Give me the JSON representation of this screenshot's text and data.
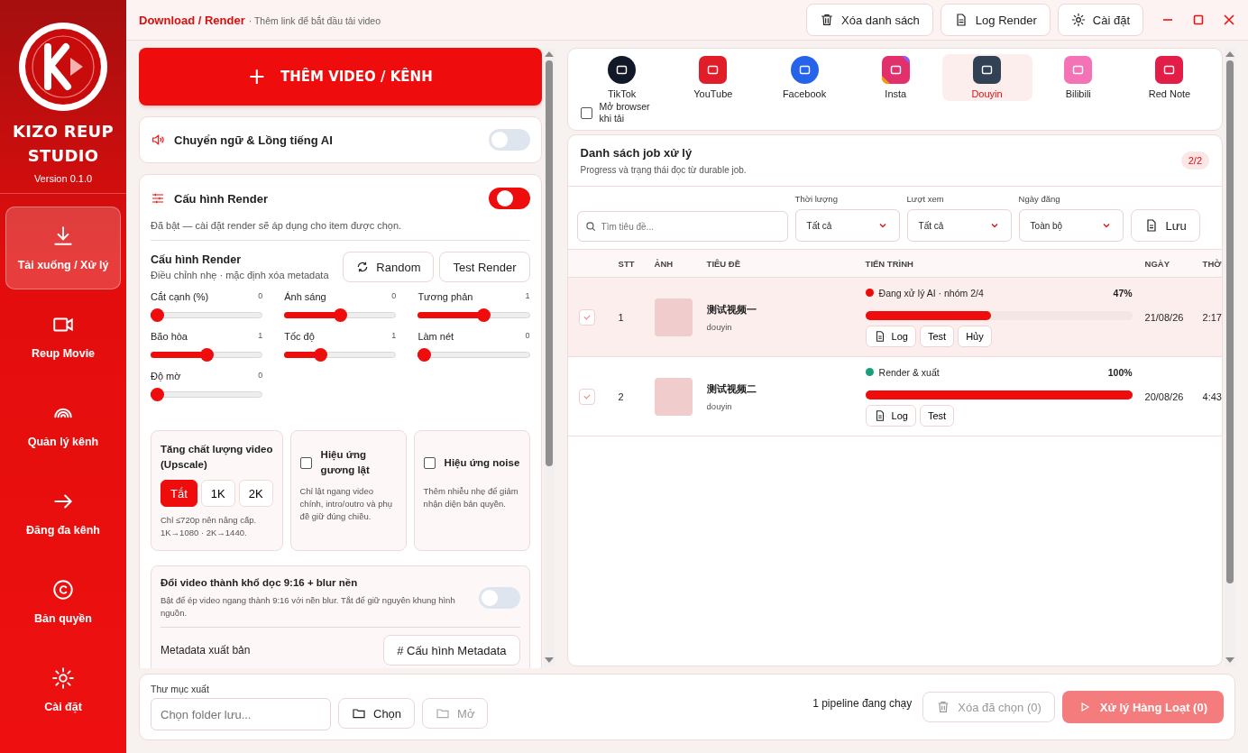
{
  "app": {
    "name_line1": "KIZO REUP",
    "name_line2": "STUDIO",
    "version": "Version 0.1.0"
  },
  "nav": [
    {
      "label": "Tải xuống / Xử lý",
      "kind": "download",
      "selected": true
    },
    {
      "label": "Reup Movie",
      "kind": "video",
      "selected": false
    },
    {
      "label": "Quản lý kênh",
      "kind": "signal",
      "selected": false
    },
    {
      "label": "Đăng đa kênh",
      "kind": "arrow",
      "selected": false
    },
    {
      "label": "Bản quyền",
      "kind": "copyright",
      "selected": false
    },
    {
      "label": "Cài đặt",
      "kind": "gear",
      "selected": false
    }
  ],
  "header": {
    "title": "Download / Render",
    "subtitle": "· Thêm link để bắt đầu tải video",
    "buttons": [
      {
        "label": "Xóa danh sách",
        "kind": "trash"
      },
      {
        "label": "Log Render",
        "kind": "doc"
      },
      {
        "label": "Cài đặt",
        "kind": "gear"
      }
    ]
  },
  "add_button": {
    "icon": "+",
    "label": "THÊM VIDEO / KÊNH"
  },
  "ai_card": {
    "title": "Chuyển ngữ & Lồng tiếng AI",
    "on": false
  },
  "render_card": {
    "title": "Cấu hình Render",
    "on": true,
    "note": "Đã bật — cài đặt render sẽ áp dụng cho item được chọn.",
    "section_title": "Cấu hình Render",
    "section_sub": "Điều chỉnh nhẹ · mặc định xóa metadata",
    "random": "Random",
    "test": "Test Render",
    "sliders": [
      {
        "label": "Cắt cạnh (%)",
        "reading": "0",
        "level": 0
      },
      {
        "label": "Ánh sáng",
        "reading": "0",
        "level": 0.5
      },
      {
        "label": "Tương phản",
        "reading": "1",
        "level": 0.6
      },
      {
        "label": "Bão hòa",
        "reading": "1",
        "level": 0.5
      },
      {
        "label": "Tốc độ",
        "reading": "1",
        "level": 0.3
      },
      {
        "label": "Làm nét",
        "reading": "0",
        "level": 0
      },
      {
        "label": "Độ mờ",
        "reading": "0",
        "level": 0
      }
    ],
    "upscale": {
      "title": "Tăng chất lượng video (Upscale)",
      "options": [
        {
          "label": "Tắt",
          "selected": true
        },
        {
          "label": "1K",
          "selected": false
        },
        {
          "label": "2K",
          "selected": false
        }
      ],
      "note": "Chỉ ≤720p nên nâng cấp. 1K→1080 · 2K→1440."
    },
    "mirror": {
      "title": "Hiệu ứng gương lật",
      "checked": false,
      "note": "Chỉ lật ngang video chính, intro/outro và phụ đề giữ đúng chiều."
    },
    "noise": {
      "title": "Hiệu ứng noise",
      "checked": false,
      "note": "Thêm nhiễu nhẹ để giảm nhận diện bản quyền."
    },
    "vertical": {
      "title": "Đổi video thành khổ dọc 9:16 + blur nền",
      "note": "Bật để ép video ngang thành 9:16 với nền blur. Tắt để giữ nguyên khung hình nguồn.",
      "on": false
    },
    "metadata_label": "Metadata xuất bản",
    "metadata_button": "# Cấu hình Metadata"
  },
  "platforms": [
    {
      "label": "TikTok",
      "kind": "circle",
      "color": "#111827",
      "selected": false
    },
    {
      "label": "YouTube",
      "kind": "square",
      "color": "#e11d2a",
      "selected": false
    },
    {
      "label": "Facebook",
      "kind": "circle",
      "color": "#2563eb",
      "selected": false
    },
    {
      "label": "Insta",
      "kind": "gradient",
      "color": "#e1306c",
      "selected": false
    },
    {
      "label": "Douyin",
      "kind": "square",
      "color": "#334155",
      "selected": true
    },
    {
      "label": "Bilibili",
      "kind": "square",
      "color": "#f472b6",
      "selected": false
    },
    {
      "label": "Red Note",
      "kind": "square",
      "color": "#e11d48",
      "selected": false
    }
  ],
  "open_browser": {
    "label": "Mở browser khi tải",
    "checked": false
  },
  "jobs": {
    "title": "Danh sách job xử lý",
    "subtitle": "Progress và trạng thái đọc từ durable job.",
    "count": "2/2",
    "search_placeholder": "Tìm tiêu đề...",
    "filters": [
      {
        "label": "Thời lượng",
        "value": "Tất cả"
      },
      {
        "label": "Lượt xem",
        "value": "Tất cả"
      },
      {
        "label": "Ngày đăng",
        "value": "Toàn bộ"
      }
    ],
    "save": "Lưu",
    "columns": [
      "STT",
      "ẢNH",
      "TIÊU ĐỀ",
      "TIẾN TRÌNH",
      "NGÀY",
      "THỜ"
    ],
    "rows": [
      {
        "stt": "1",
        "title": "测试视频一",
        "source": "douyin",
        "status": "Đang xử lý AI · nhóm 2/4",
        "color": "#ef0a0a",
        "percent": "47%",
        "level": 0.47,
        "date": "21/08/26",
        "time": "2:17",
        "actions": [
          "Log",
          "Test",
          "Hủy"
        ],
        "selected": true
      },
      {
        "stt": "2",
        "title": "测试视频二",
        "source": "douyin",
        "status": "Render & xuất",
        "color": "#16a07a",
        "percent": "100%",
        "level": 1,
        "date": "20/08/26",
        "time": "4:43",
        "actions": [
          "Log",
          "Test"
        ],
        "selected": false
      }
    ]
  },
  "footer": {
    "folder_label": "Thư mục xuất",
    "folder_placeholder": "Chọn folder lưu...",
    "choose": "Chọn",
    "open": "Mở",
    "status": "1 pipeline đang chạy",
    "delete": "Xóa đã chọn (0)",
    "run": "Xử lý Hàng Loạt (0)"
  }
}
